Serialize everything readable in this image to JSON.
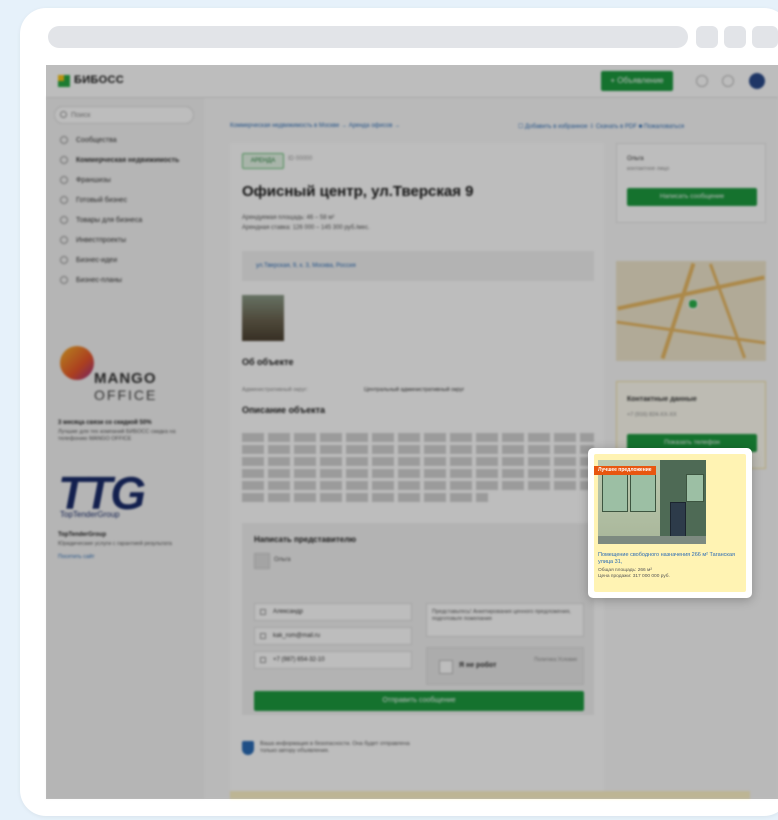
{
  "app": {
    "logo": "БИБОСС",
    "add_button": "+ Объявление"
  },
  "search": {
    "placeholder": "Поиск"
  },
  "sidebar": {
    "items": [
      {
        "label": "Сообщества",
        "active": false
      },
      {
        "label": "Коммерческая недвижимость",
        "active": true
      },
      {
        "label": "Франшизы",
        "active": false
      },
      {
        "label": "Готовый бизнес",
        "active": false
      },
      {
        "label": "Товары для бизнеса",
        "active": false
      },
      {
        "label": "Инвестпроекты",
        "active": false
      },
      {
        "label": "Бизнес-идеи",
        "active": false
      },
      {
        "label": "Бизнес-планы",
        "active": false
      }
    ],
    "ads": [
      {
        "brand": "MANGO",
        "brand2": "OFFICE",
        "title": "3 месяца связи со скидкой 50%",
        "text": "Лучшие для тех компаний БИБОСС скидка на телефонию MANGO OFFICE"
      },
      {
        "brand": "TTG",
        "brand2": "TopTenderGroup",
        "title": "TopTenderGroup",
        "text": "Юридические услуги с гарантией результата",
        "link": "Посетить сайт"
      }
    ]
  },
  "main": {
    "breadcrumb": "Коммерческая недвижимость в Москве → Аренда офисов →",
    "toplinks": "☐ Добавить в избранное   ⇩ Скачать в PDF   ■ Пожаловаться",
    "tag": "АРЕНДА",
    "id_text": "ID 00000",
    "title": "Офисный центр, ул.Тверская 9",
    "area": "Арендуемая площадь: 46 – 58 м²",
    "price": "Арендная ставка: 126 000 – 145 300 руб./мес.",
    "address": "ул.Тверская, 9, к. 3, Москва, Россия",
    "about_title": "Об объекте",
    "district_key": "Административный округ:",
    "district_value": "Центральный административный округ",
    "desc_title": "Описание объекта"
  },
  "form": {
    "title": "Написать представителю",
    "user": "Ольга",
    "name_value": "Александр",
    "email_value": "kak_rom@mail.ru",
    "phone_value": "+7 (987) 654-32-10",
    "note": "Представьтесь! Анкетирования ценного предложения, подготовьте пожелания",
    "captcha_label": "Я не робот",
    "captcha_small": "Политика Условия",
    "send_label": "Отправить сообщение",
    "safe_text": "Ваша информация в безопасности. Она будет отправлена только автору объявления."
  },
  "right": {
    "seller_name": "Ольга",
    "seller_sub": "контактное лицо",
    "message_button": "Написать сообщение",
    "contacts_title": "Контактные данные",
    "contacts_phone": "+7 (916) 824-XX-XX",
    "phone_button": "Показать телефон"
  },
  "highlight": {
    "badge": "Лучшее предложение",
    "title": "Помещение свободного назначения 266 м² Таганская улица 31,",
    "meta1": "Общая площадь: 266 м²",
    "meta2": "Цена продажи: 317 000 000 руб."
  },
  "colors": {
    "accent_green": "#1d9a3f",
    "link_blue": "#2a6bb5",
    "badge_orange": "#e8560f",
    "highlight_bg": "#fff3b3"
  }
}
